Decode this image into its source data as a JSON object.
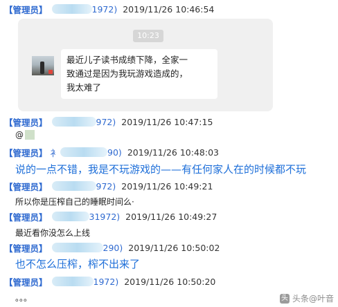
{
  "chat": {
    "messages": [
      {
        "role": "【管理员】",
        "name_tail": "1972)",
        "timestamp": "2019/11/26 10:46:54",
        "reply": {
          "time": "10:23",
          "lines": [
            "最近儿子读书成绩下降，全家一",
            "致通过是因为我玩游戏造成的，",
            "我太难了"
          ]
        }
      },
      {
        "role": "【管理员】",
        "name_tail": "972)",
        "timestamp": "2019/11/26 10:47:15",
        "mention": "@"
      },
      {
        "role": "【管理员】",
        "name_prefix": "衤",
        "name_tail": "90)",
        "timestamp": "2019/11/26 10:48:03",
        "text": "说的一点不错，我是不玩游戏的——有任何家人在的时候都不玩"
      },
      {
        "role": "【管理员】",
        "name_tail": "972)",
        "timestamp": "2019/11/26 10:49:21",
        "text": "所以你是压榨自己的睡眠时间么·"
      },
      {
        "role": "【管理员】",
        "name_tail": "31972)",
        "timestamp": "2019/11/26 10:49:27",
        "text": "最近看你没怎么上线"
      },
      {
        "role": "【管理员】",
        "name_tail": "290)",
        "timestamp": "2019/11/26 10:50:02",
        "text": "也不怎么压榨，榨不出来了"
      },
      {
        "role": "【管理员】",
        "name_tail": "1972)",
        "timestamp": "2019/11/26 10:50:20",
        "text": "。。。"
      }
    ]
  },
  "watermark": {
    "logo": "头",
    "text": "头条@叶音"
  }
}
